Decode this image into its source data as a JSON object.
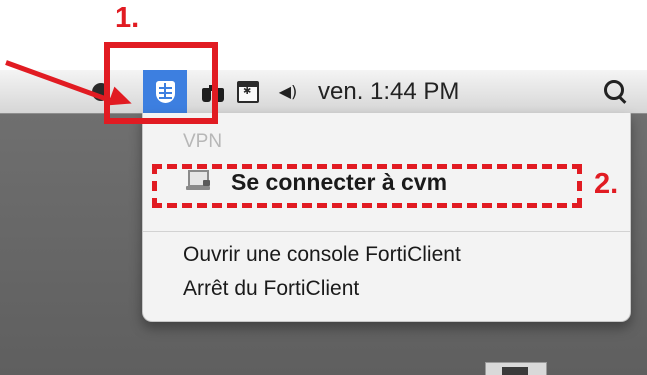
{
  "annotations": {
    "step1": "1.",
    "step2": "2.",
    "accent_color": "#e11b22"
  },
  "menubar": {
    "clock": "ven. 1:44 PM",
    "icons": [
      "app-icon",
      "forticlient-shield-icon",
      "binoculars-icon",
      "keyboard-viewer-icon",
      "volume-icon",
      "spotlight-search-icon"
    ],
    "highlight_color": "#3d7fe0"
  },
  "menu": {
    "header": "VPN",
    "connect_item": "Se connecter à cvm",
    "console_item": "Ouvrir une console FortiClient",
    "quit_item": "Arrêt du FortiClient"
  }
}
